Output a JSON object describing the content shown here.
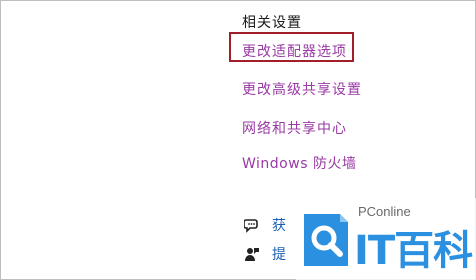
{
  "related_settings": {
    "title": "相关设置",
    "links": [
      {
        "label": "更改适配器选项",
        "highlighted": true
      },
      {
        "label": "更改高级共享设置"
      },
      {
        "label": "网络和共享中心"
      },
      {
        "label": "Windows 防火墙"
      }
    ]
  },
  "help": {
    "items": [
      {
        "label": "获",
        "icon": "chat-help-icon"
      },
      {
        "label": "提",
        "icon": "feedback-person-icon"
      }
    ]
  },
  "watermark": {
    "brand": "PConline",
    "name": "IT百科"
  },
  "colors": {
    "link": "#9a3aa5",
    "highlight_border": "#a11e2a",
    "watermark_blue": "#2c90e0"
  }
}
